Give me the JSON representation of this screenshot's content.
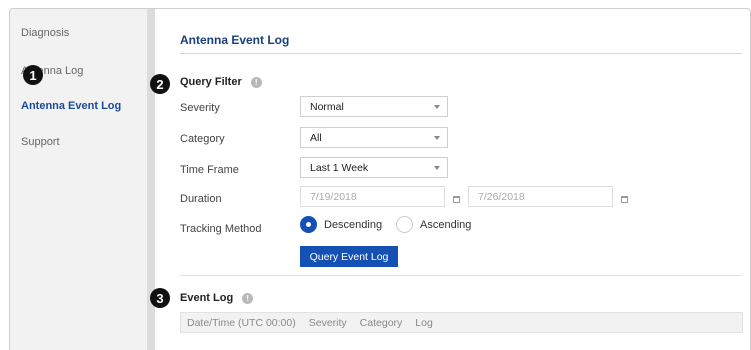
{
  "sidebar": {
    "items": [
      {
        "label": "Diagnosis"
      },
      {
        "label": "Antenna Log"
      },
      {
        "label": "Antenna Event Log"
      },
      {
        "label": "Support"
      }
    ]
  },
  "page_title": "Antenna Event Log",
  "query_filter": {
    "title": "Query Filter",
    "severity": {
      "label": "Severity",
      "value": "Normal"
    },
    "category": {
      "label": "Category",
      "value": "All"
    },
    "time_frame": {
      "label": "Time Frame",
      "value": "Last 1 Week"
    },
    "duration": {
      "label": "Duration",
      "start": "7/19/2018",
      "end": "7/26/2018"
    },
    "tracking_method": {
      "label": "Tracking Method",
      "options": [
        "Descending",
        "Ascending"
      ],
      "selected": "Descending"
    },
    "query_button": "Query Event Log"
  },
  "event_log": {
    "title": "Event Log",
    "columns": [
      "Date/Time (UTC 00:00)",
      "Severity",
      "Category",
      "Log"
    ]
  },
  "callouts": [
    "1",
    "2",
    "3"
  ],
  "colors": {
    "accent": "#1550b5",
    "title": "#1a3f7a",
    "sidebar_bg": "#f2f2f2"
  }
}
